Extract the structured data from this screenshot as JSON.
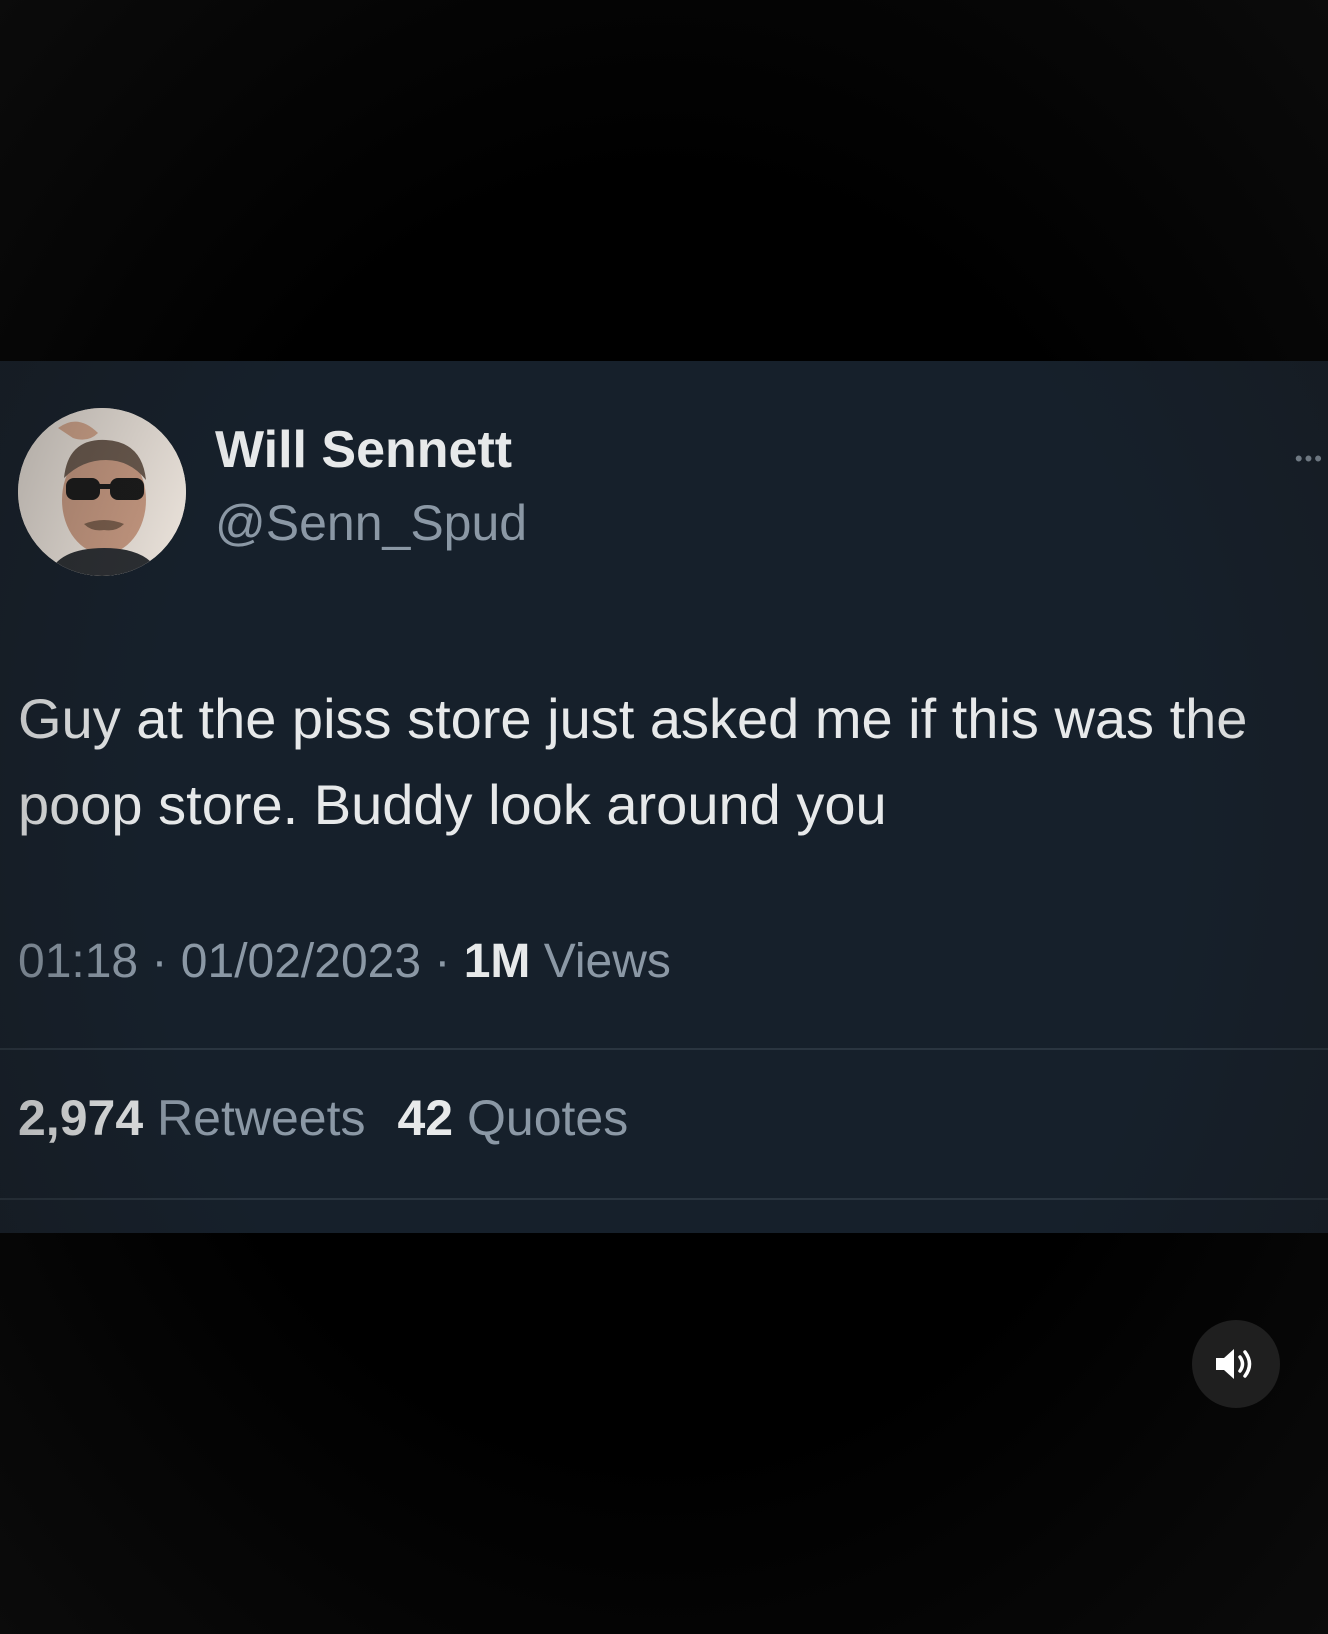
{
  "tweet": {
    "author_name": "Will Sennett",
    "author_handle": "@Senn_Spud",
    "more_icon": "more-dots-icon",
    "text": "Guy at the piss store just asked me if this was the poop store. Buddy look around you",
    "time": "01:18",
    "date": "01/02/2023",
    "separator": "·",
    "views_count": "1M",
    "views_label": "Views",
    "retweets_count": "2,974",
    "retweets_label": "Retweets",
    "quotes_count": "42",
    "quotes_label": "Quotes"
  },
  "player": {
    "sound_icon": "speaker-volume-icon"
  },
  "colors": {
    "tweet_background": "#16202b",
    "primary_text": "#e7e9ea",
    "secondary_text": "#8b98a5",
    "page_background": "#000000"
  }
}
